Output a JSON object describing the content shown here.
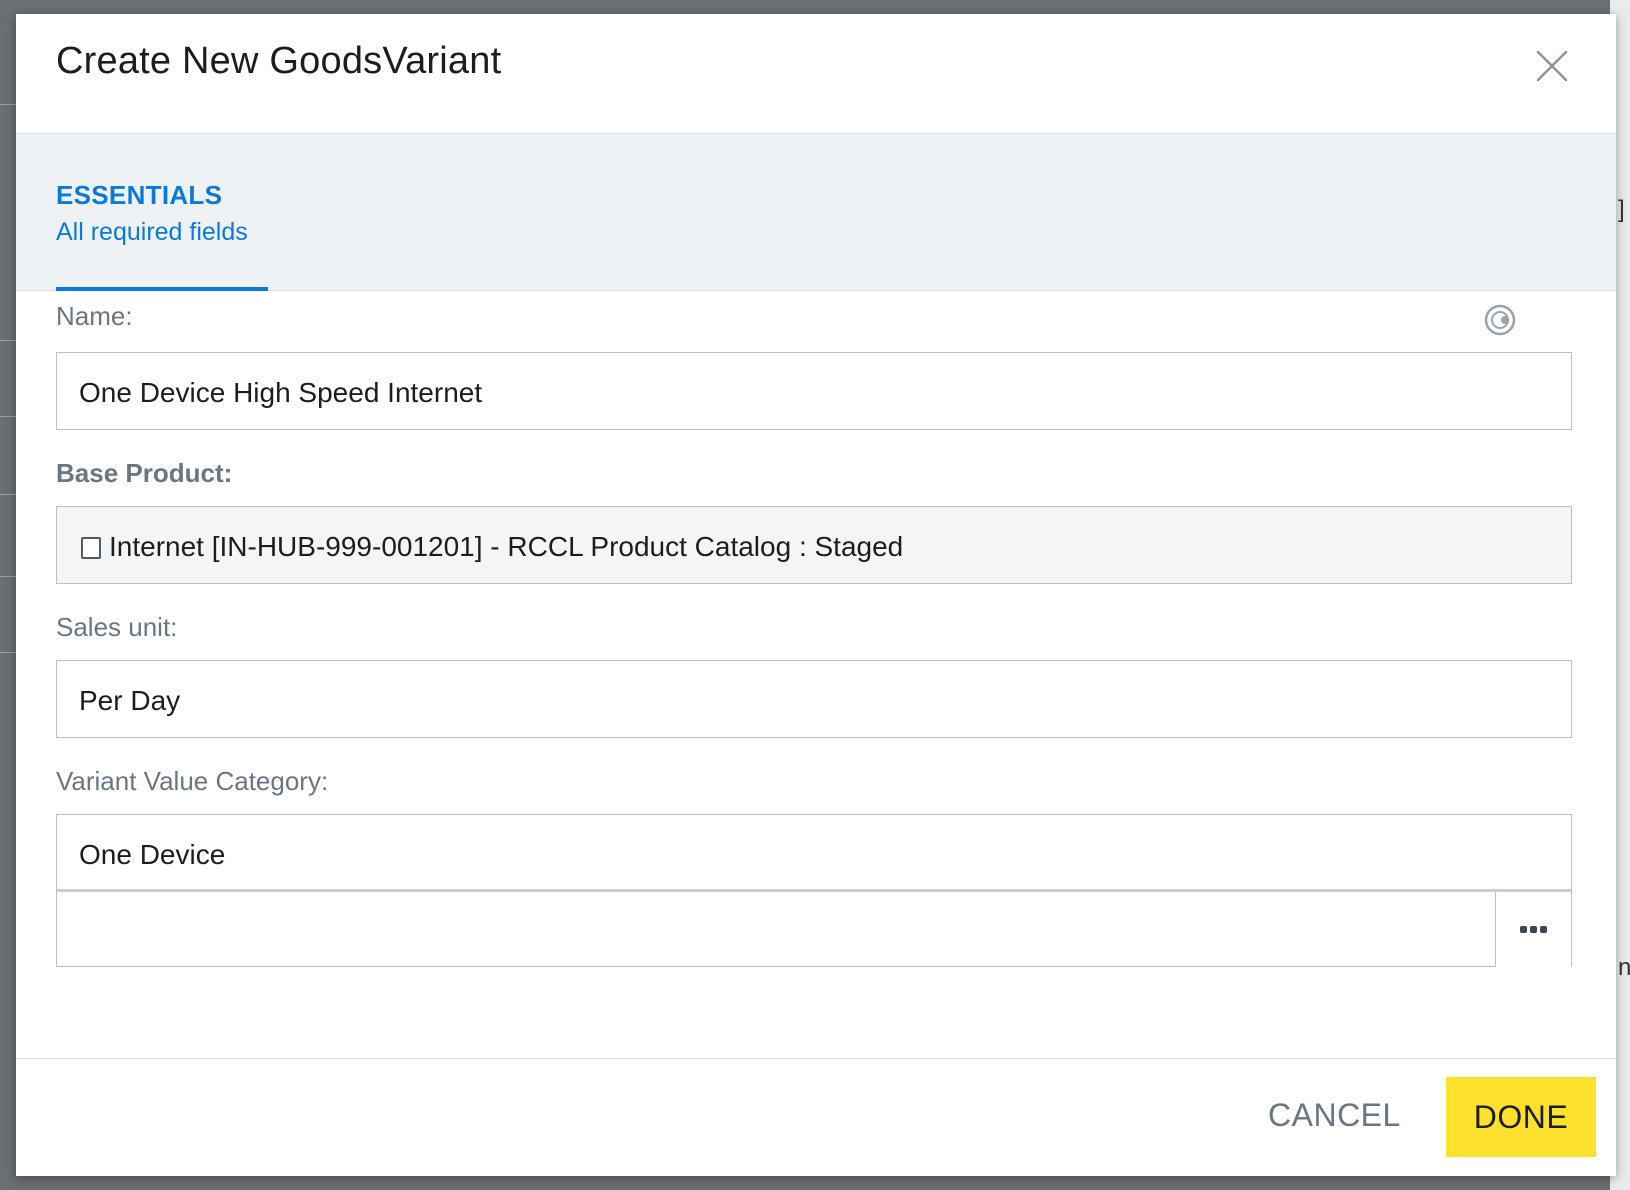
{
  "dialog": {
    "title": "Create New GoodsVariant",
    "close_icon": "close-icon"
  },
  "tabs": [
    {
      "title": "ESSENTIALS",
      "subtitle": "All required fields",
      "active": true
    }
  ],
  "fields": {
    "name": {
      "label": "Name:",
      "value": "One Device High Speed Internet",
      "info_icon": "language-globe-icon"
    },
    "base_product": {
      "label": "Base Product:",
      "value": "Internet [IN-HUB-999-001201] - RCCL Product Catalog : Staged",
      "checkbox_icon": "checkbox-icon"
    },
    "sales_unit": {
      "label": "Sales unit:",
      "value": "Per Day"
    },
    "variant_value_category": {
      "label": "Variant Value Category:",
      "value": "One Device",
      "extra_input_value": "",
      "browse_icon": "ellipsis-icon"
    }
  },
  "footer": {
    "cancel_label": "CANCEL",
    "done_label": "DONE"
  },
  "colors": {
    "accent": "#0b7ad6",
    "primary_button": "#fde12d",
    "tab_band": "#eff2f5",
    "label": "#6a7682"
  }
}
